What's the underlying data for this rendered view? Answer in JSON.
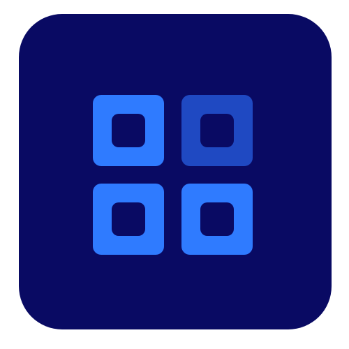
{
  "icon": {
    "name": "grid-apps-icon",
    "colors": {
      "background": "#090a63",
      "tile_bright": "#2f7bff",
      "tile_dim": "#1f49c2",
      "page": "#ffffff"
    },
    "tiles": [
      {
        "id": "top-left",
        "state": "bright"
      },
      {
        "id": "top-right",
        "state": "dim"
      },
      {
        "id": "bottom-left",
        "state": "bright"
      },
      {
        "id": "bottom-right",
        "state": "bright"
      }
    ]
  }
}
